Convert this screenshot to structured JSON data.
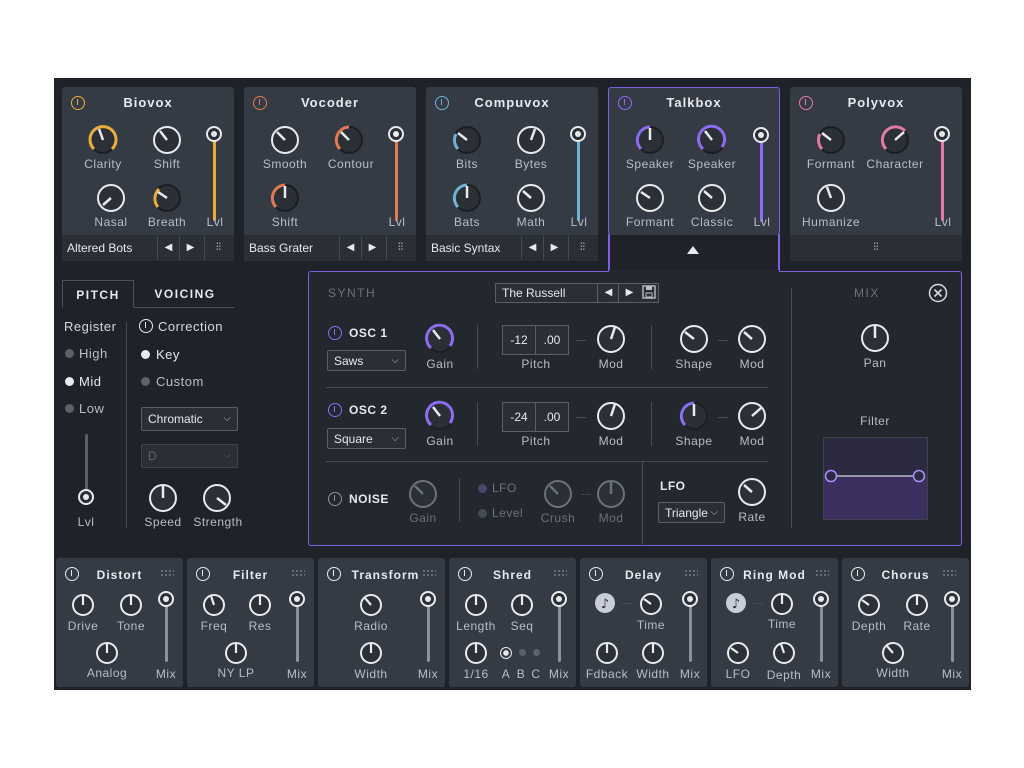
{
  "modules": [
    {
      "name": "Biovox",
      "color": "#e8ad3c",
      "knobs": [
        "Clarity",
        "Shift",
        "Nasal",
        "Breath"
      ],
      "level_label": "Lvl",
      "preset": "Altered Bots"
    },
    {
      "name": "Vocoder",
      "color": "#e07a55",
      "knobs": [
        "Smooth",
        "Contour",
        "Shift"
      ],
      "level_label": "Lvl",
      "preset": "Bass Grater"
    },
    {
      "name": "Compuvox",
      "color": "#6fb2d4",
      "knobs": [
        "Bits",
        "Bytes",
        "Bats",
        "Math"
      ],
      "level_label": "Lvl",
      "preset": "Basic Syntax"
    },
    {
      "name": "Talkbox",
      "color": "#8c6cf0",
      "knobs": [
        "Speaker",
        "Speaker",
        "Formant",
        "Classic"
      ],
      "level_label": "Lvl"
    },
    {
      "name": "Polyvox",
      "color": "#e07aa6",
      "knobs": [
        "Formant",
        "Character",
        "Humanize"
      ],
      "level_label": "Lvl"
    }
  ],
  "left_panel": {
    "tabs": [
      "PITCH",
      "VOICING"
    ],
    "register_label": "Register",
    "register_options": [
      "High",
      "Mid",
      "Low"
    ],
    "register_selected": "Mid",
    "correction_label": "Correction",
    "correction_options": [
      "Key",
      "Custom"
    ],
    "correction_selected": "Key",
    "scale_select": "Chromatic",
    "key_select": "D",
    "level_label": "Lvl",
    "knobs": [
      "Speed",
      "Strength"
    ]
  },
  "synth": {
    "section_label": "SYNTH",
    "preset": "The Russell",
    "mix_label": "MIX",
    "osc1": {
      "label": "OSC 1",
      "wave": "Saws",
      "pitch_coarse": "-12",
      "pitch_fine": ".00",
      "labels": [
        "Gain",
        "Pitch",
        "Mod",
        "Shape",
        "Mod"
      ]
    },
    "osc2": {
      "label": "OSC 2",
      "wave": "Square",
      "pitch_coarse": "-24",
      "pitch_fine": ".00",
      "labels": [
        "Gain",
        "Pitch",
        "Mod",
        "Shape",
        "Mod"
      ]
    },
    "noise": {
      "label": "NOISE",
      "labels": [
        "Gain",
        "LFO",
        "Level",
        "Crush",
        "Mod"
      ]
    },
    "lfo": {
      "label": "LFO",
      "shape": "Triangle",
      "rate_label": "Rate"
    },
    "pan_label": "Pan",
    "filter_label": "Filter"
  },
  "effects": [
    {
      "name": "Distort",
      "labels": [
        "Drive",
        "Tone",
        "Analog",
        "Mix"
      ]
    },
    {
      "name": "Filter",
      "labels": [
        "Freq",
        "Res",
        "NY LP",
        "Mix"
      ]
    },
    {
      "name": "Transform",
      "labels": [
        "Radio",
        "Width",
        "Mix"
      ]
    },
    {
      "name": "Shred",
      "labels": [
        "Length",
        "Seq",
        "1/16",
        "A",
        "B",
        "C",
        "Mix"
      ]
    },
    {
      "name": "Delay",
      "labels": [
        "Time",
        "Fdback",
        "Width",
        "Mix"
      ]
    },
    {
      "name": "Ring Mod",
      "labels": [
        "Time",
        "LFO",
        "Depth",
        "Mix"
      ]
    },
    {
      "name": "Chorus",
      "labels": [
        "Depth",
        "Rate",
        "Width",
        "Mix"
      ]
    }
  ]
}
